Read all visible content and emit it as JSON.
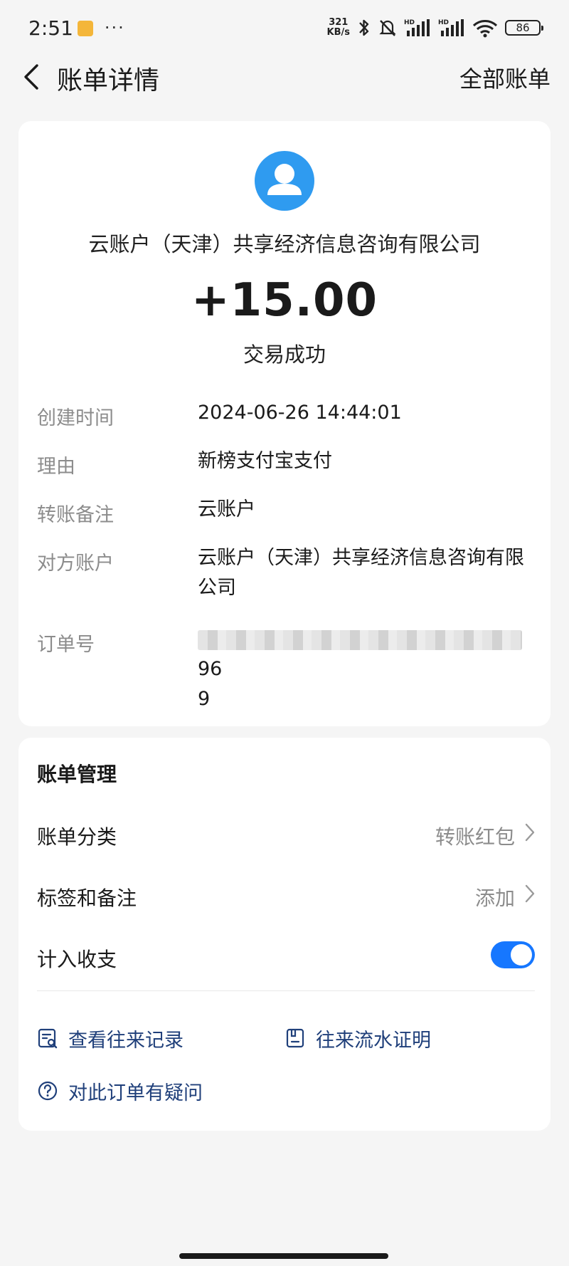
{
  "status_bar": {
    "time": "2:51",
    "dots": "···",
    "net_speed_value": "321",
    "net_speed_unit": "KB/s",
    "battery": "86"
  },
  "header": {
    "title": "账单详情",
    "right_link": "全部账单"
  },
  "transaction": {
    "payee": "云账户（天津）共享经济信息咨询有限公司",
    "amount": "+15.00",
    "status": "交易成功",
    "details": [
      {
        "label": "创建时间",
        "value": "2024-06-26 14:44:01"
      },
      {
        "label": "理由",
        "value": "新榜支付宝支付"
      },
      {
        "label": "转账备注",
        "value": "云账户"
      },
      {
        "label": "对方账户",
        "value": "云账户（天津）共享经济信息咨询有限公司"
      },
      {
        "label": "订单号",
        "value_suffix": "96",
        "value_line2": "9"
      }
    ]
  },
  "manage": {
    "title": "账单管理",
    "category_label": "账单分类",
    "category_value": "转账红包",
    "tags_label": "标签和备注",
    "tags_value": "添加",
    "count_label": "计入收支",
    "count_enabled": true,
    "links": {
      "records": "查看往来记录",
      "proof": "往来流水证明",
      "question": "对此订单有疑问"
    }
  },
  "colors": {
    "accent": "#1677ff",
    "avatar": "#2f9bf0",
    "link": "#1f3f7a"
  }
}
